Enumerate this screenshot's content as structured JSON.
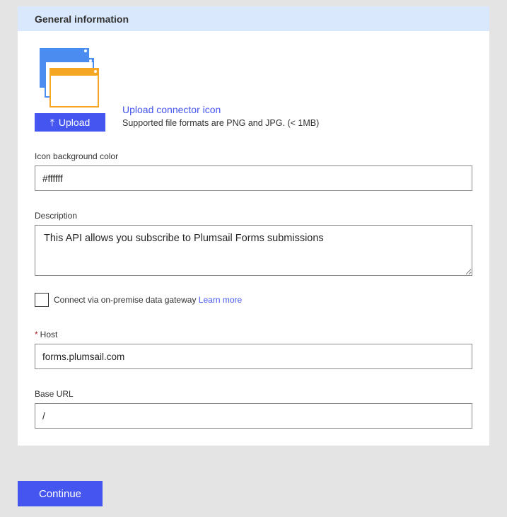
{
  "section": {
    "title": "General information"
  },
  "icon_upload": {
    "button_label": "Upload",
    "link_text": "Upload connector icon",
    "hint": "Supported file formats are PNG and JPG. (< 1MB)",
    "icon_colors": {
      "back_windows": "#4a8cf0",
      "front_window": "#f5a623"
    }
  },
  "fields": {
    "icon_bg": {
      "label": "Icon background color",
      "value": "#ffffff"
    },
    "description": {
      "label": "Description",
      "value": "This API allows you subscribe to Plumsail Forms submissions"
    },
    "gateway": {
      "label": "Connect via on-premise data gateway",
      "link": "Learn more",
      "checked": false
    },
    "host": {
      "required_mark": "*",
      "label": "Host",
      "value": "forms.plumsail.com"
    },
    "base_url": {
      "label": "Base URL",
      "value": "/"
    }
  },
  "footer": {
    "continue_label": "Continue"
  },
  "colors": {
    "accent": "#4455f0",
    "header_bg": "#d9e8fc",
    "page_bg": "#e4e4e4"
  }
}
